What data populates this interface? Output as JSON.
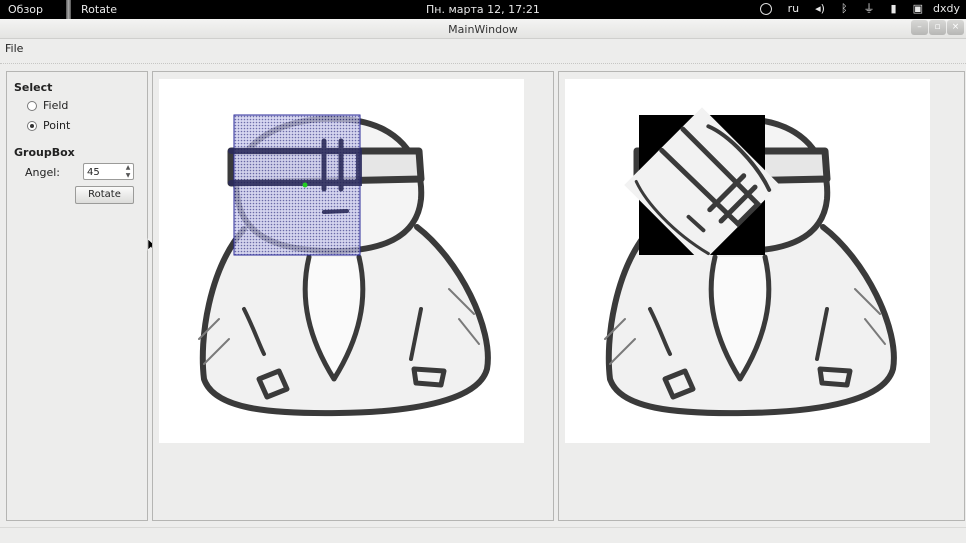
{
  "topbar": {
    "activities": "Обзор",
    "app_name": "Rotate",
    "clock": "Пн. марта 12, 17:21",
    "tray": {
      "accessibility_icon": "accessibility-icon",
      "lang": "ru",
      "volume_icon": "volume-icon",
      "bluetooth_icon": "bluetooth-icon",
      "network_icon": "network-icon",
      "battery_icon": "battery-icon",
      "user_icon": "user-icon",
      "user": "dxdy"
    }
  },
  "window": {
    "title": "MainWindow",
    "buttons": {
      "minimize": "–",
      "maximize": "▫",
      "close": "×"
    }
  },
  "menu": {
    "file": "File"
  },
  "controls": {
    "select_title": "Select",
    "radio_field": "Field",
    "radio_point": "Point",
    "selected": "Point",
    "groupbox_title": "GroupBox",
    "angle_label": "Angel:",
    "angle_value": "45",
    "rotate_button": "Rotate"
  },
  "colors": {
    "selection_fill": "#3c3c8c",
    "selection_border": "#2a2a9a",
    "point_marker": "#22cc22"
  }
}
